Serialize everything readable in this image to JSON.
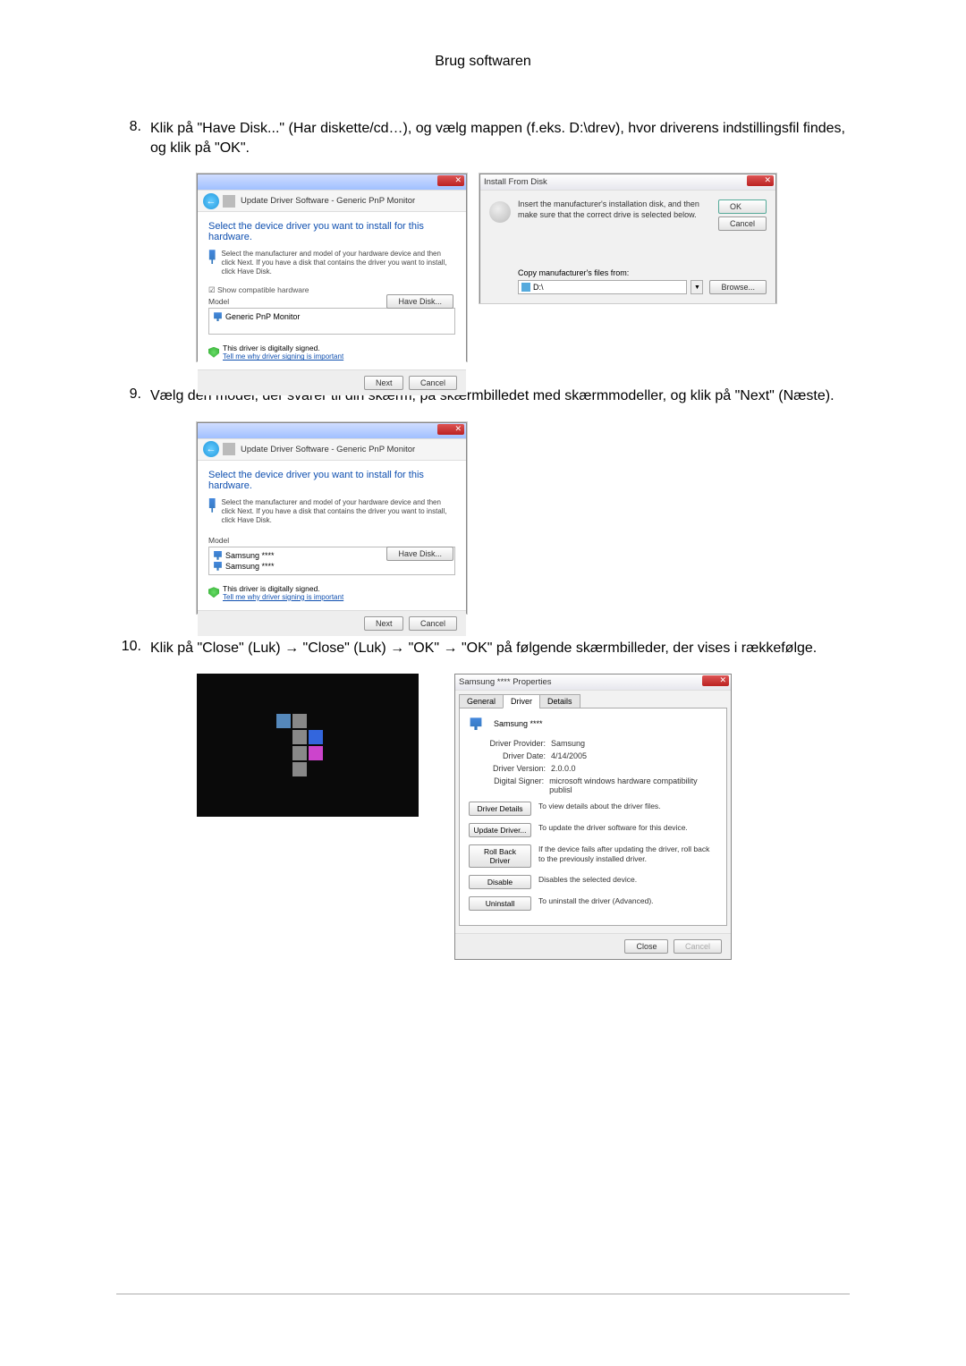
{
  "page_title": "Brug softwaren",
  "steps": {
    "s8": {
      "num": "8.",
      "text": "Klik på \"Have Disk...\" (Har diskette/cd…), og vælg mappen (f.eks. D:\\drev), hvor driverens indstillingsfil findes, og klik på \"OK\"."
    },
    "s9": {
      "num": "9.",
      "text": "Vælg den model, der svarer til din skærm, på skærmbilledet med skærmmodeller, og klik på \"Next\" (Næste)."
    },
    "s10": {
      "num": "10.",
      "text": "Klik på \"Close\" (Luk) → \"Close\" (Luk) → \"OK\" → \"OK\" på følgende skærmbilleder, der vises i rækkefølge."
    }
  },
  "update_driver": {
    "breadcrumb": "Update Driver Software - Generic PnP Monitor",
    "heading": "Select the device driver you want to install for this hardware.",
    "instruction": "Select the manufacturer and model of your hardware device and then click Next. If you have a disk that contains the driver you want to install, click Have Disk.",
    "show_compatible": "Show compatible hardware",
    "model_label": "Model",
    "model_generic": "Generic PnP Monitor",
    "signed": "This driver is digitally signed.",
    "signed_link": "Tell me why driver signing is important",
    "have_disk_btn": "Have Disk...",
    "next_btn": "Next",
    "cancel_btn": "Cancel"
  },
  "install_from_disk": {
    "title": "Install From Disk",
    "text": "Insert the manufacturer's installation disk, and then make sure that the correct drive is selected below.",
    "ok_btn": "OK",
    "cancel_btn": "Cancel",
    "copy_label": "Copy manufacturer's files from:",
    "path": "D:\\",
    "browse_btn": "Browse..."
  },
  "update_driver2": {
    "model_a": "Samsung ****",
    "model_b": "Samsung ****"
  },
  "properties": {
    "title": "Samsung **** Properties",
    "tabs": {
      "general": "General",
      "driver": "Driver",
      "details": "Details"
    },
    "device_name": "Samsung ****",
    "provider_label": "Driver Provider:",
    "provider_value": "Samsung",
    "date_label": "Driver Date:",
    "date_value": "4/14/2005",
    "version_label": "Driver Version:",
    "version_value": "2.0.0.0",
    "signer_label": "Digital Signer:",
    "signer_value": "microsoft windows hardware compatibility publisl",
    "details_btn": "Driver Details",
    "details_desc": "To view details about the driver files.",
    "update_btn": "Update Driver...",
    "update_desc": "To update the driver software for this device.",
    "rollback_btn": "Roll Back Driver",
    "rollback_desc": "If the device fails after updating the driver, roll back to the previously installed driver.",
    "disable_btn": "Disable",
    "disable_desc": "Disables the selected device.",
    "uninstall_btn": "Uninstall",
    "uninstall_desc": "To uninstall the driver (Advanced).",
    "close_btn": "Close",
    "cancel_btn": "Cancel"
  }
}
